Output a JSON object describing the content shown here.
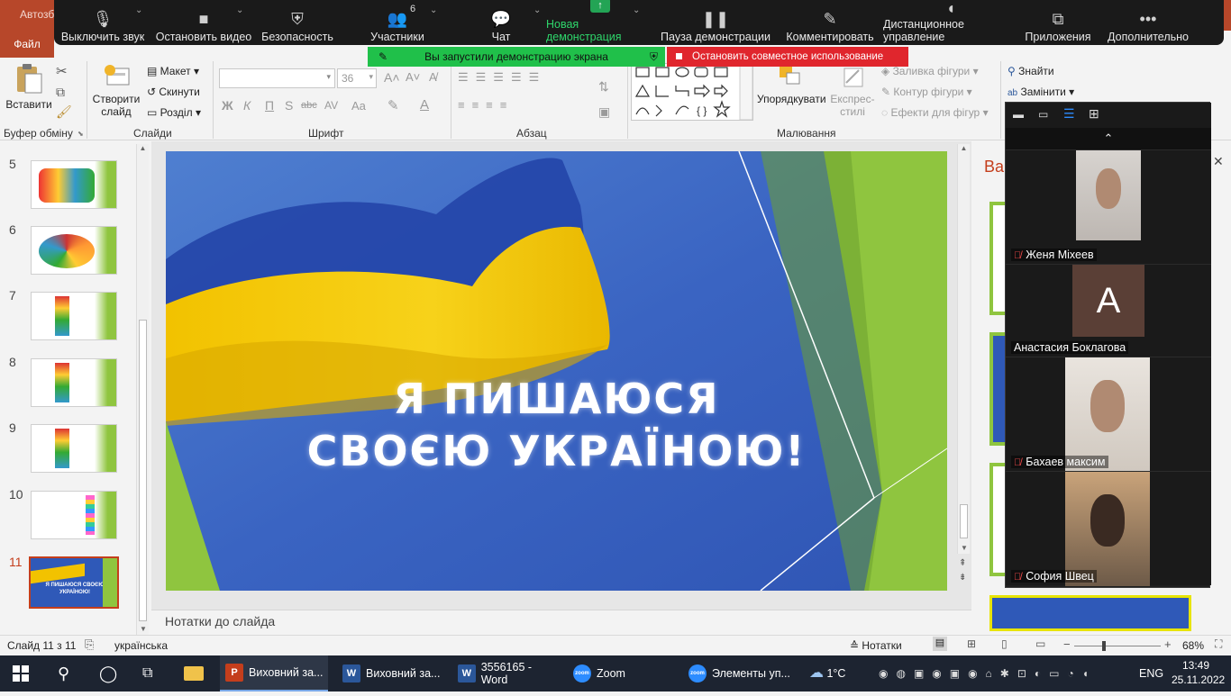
{
  "ppt": {
    "autosave": "Автозб",
    "file_tab": "Файл",
    "groups": {
      "clipboard": "Буфер обміну",
      "slides": "Слайди",
      "font": "Шрифт",
      "paragraph": "Абзац",
      "drawing": "Малювання"
    },
    "buttons": {
      "paste": "Вставити",
      "new_slide": "Створити слайд",
      "layout": "Макет",
      "reset": "Скинути",
      "section": "Розділ",
      "font_size": "36",
      "arrange": "Упорядкувати",
      "quick_styles": "Експрес-стилі",
      "shape_fill": "Заливка фігури",
      "shape_outline": "Контур фігури",
      "shape_effects": "Ефекти для фігур",
      "find": "Знайти",
      "replace": "Замінити",
      "bold": "Ж",
      "italic": "К",
      "underline": "П",
      "strike": "abc",
      "shadow": "S",
      "char_spacing": "AV",
      "case": "Aa"
    },
    "thumbnails": [
      {
        "num": "5"
      },
      {
        "num": "6"
      },
      {
        "num": "7"
      },
      {
        "num": "8"
      },
      {
        "num": "9"
      },
      {
        "num": "10"
      },
      {
        "num": "11",
        "text": "Я ПИШАЮСЯ СВОЄЮ УКРАЇНОЮ!"
      }
    ],
    "slide": {
      "line1": "Я ПИШАЮСЯ",
      "line2": "СВОЄЮ УКРАЇНОЮ!"
    },
    "notes_placeholder": "Нотатки до слайда",
    "right_panel_title": "Ва",
    "status": {
      "slide_counter": "Слайд 11 з 11",
      "language": "українська",
      "notes_btn": "Нотатки",
      "zoom_pct": "68%",
      "zoom_level": 0.68
    }
  },
  "zoom": {
    "toolbar": [
      {
        "icon": "microphone-icon",
        "label": "Выключить звук"
      },
      {
        "icon": "video-camera-icon",
        "label": "Остановить видео"
      },
      {
        "icon": "shield-icon",
        "label": "Безопасность"
      },
      {
        "icon": "participants-icon",
        "label": "Участники",
        "count": "6"
      },
      {
        "icon": "chat-bubble-icon",
        "label": "Чат"
      },
      {
        "icon": "share-screen-icon",
        "label": "Новая демонстрация"
      },
      {
        "icon": "pause-icon",
        "label": "Пауза демонстрации"
      },
      {
        "icon": "pen-icon",
        "label": "Комментировать"
      },
      {
        "icon": "mouse-icon",
        "label": "Дистанционное управление"
      },
      {
        "icon": "apps-icon",
        "label": "Приложения"
      },
      {
        "icon": "more-icon",
        "label": "Дополнительно"
      }
    ],
    "banner_sharing": "Вы запустили демонстрацию экрана",
    "banner_stop": "Остановить совместное использование",
    "participants": [
      {
        "name": "Женя Міхеев",
        "muted": true,
        "video": true
      },
      {
        "name": "Анастасия Боклагова",
        "muted": false,
        "video": false,
        "initial": "A"
      },
      {
        "name": "Бахаев максим",
        "muted": true,
        "video": true
      },
      {
        "name": "София Швец",
        "muted": true,
        "video": true
      }
    ]
  },
  "taskbar": {
    "apps": [
      {
        "label": "Виховний за...",
        "icon": "P",
        "color": "#c43e1c",
        "active": true
      },
      {
        "label": "Виховний за...",
        "icon": "W",
        "color": "#2b579a",
        "active": false
      },
      {
        "label": "3556165 - Word",
        "icon": "W",
        "color": "#2b579a",
        "active": false
      },
      {
        "label": "Zoom",
        "icon": "zoom",
        "color": "#2d8cff",
        "active": false
      },
      {
        "label": "Элементы уп...",
        "icon": "zoom",
        "color": "#2d8cff",
        "active": false
      }
    ],
    "weather": "1°C",
    "lang": "ENG",
    "time": "13:49",
    "date": "25.11.2022"
  },
  "colors": {
    "ppt_red": "#b7472a",
    "share_green": "#20c04a",
    "stop_red": "#e0262d",
    "slide_blue": "#2f59b8",
    "accent_green": "#8fc53f"
  }
}
